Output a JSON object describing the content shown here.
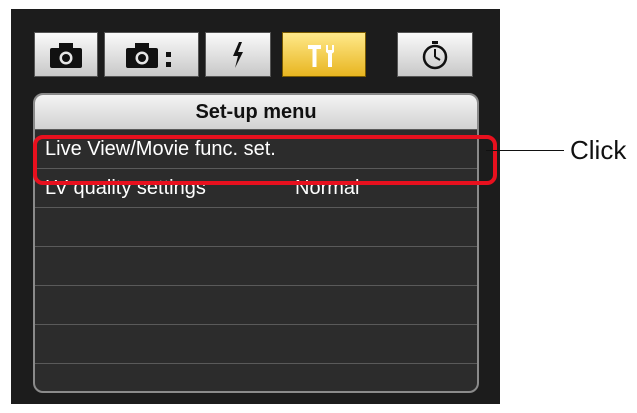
{
  "tabs": [
    {
      "name": "shooting-menu-tab",
      "icon": "camera-icon",
      "active": false
    },
    {
      "name": "shooting-menu-2-tab",
      "icon": "camera-colon-icon",
      "active": false
    },
    {
      "name": "flash-tab",
      "icon": "flash-icon",
      "active": false
    },
    {
      "name": "setup-tab",
      "icon": "wrench-tools-icon",
      "active": true
    },
    {
      "name": "timer-tab",
      "icon": "timer-icon",
      "active": false
    }
  ],
  "menu": {
    "title": "Set-up menu",
    "items": [
      {
        "label": "Live View/Movie func. set.",
        "value": ""
      },
      {
        "label": "LV quality settings",
        "value": "Normal"
      },
      {
        "label": "",
        "value": ""
      },
      {
        "label": "",
        "value": ""
      },
      {
        "label": "",
        "value": ""
      },
      {
        "label": "",
        "value": ""
      },
      {
        "label": "",
        "value": ""
      }
    ]
  },
  "annotation": {
    "callout_label": "Click",
    "highlight_color": "#e8101e"
  },
  "colors": {
    "panel_bg": "#1c1c1c",
    "active_tab": "#f2c83a"
  }
}
